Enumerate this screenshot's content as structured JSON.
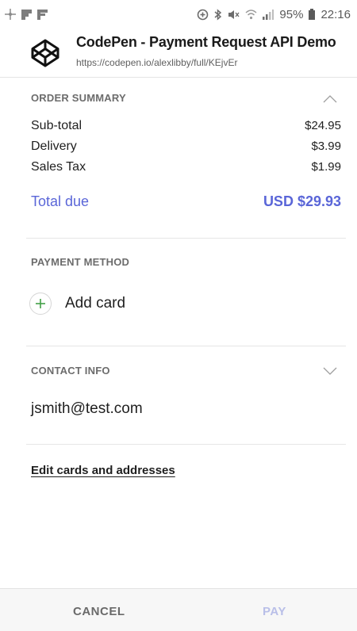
{
  "status_bar": {
    "left_icons": [
      "sync-icon",
      "flipboard-icon",
      "flipboard-alt-icon"
    ],
    "right_icons": [
      "data-saver-icon",
      "bluetooth-icon",
      "mute-icon",
      "wifi-icon",
      "signal-icon",
      "battery-icon"
    ],
    "battery": "95%",
    "time": "22:16"
  },
  "header": {
    "title": "CodePen - Payment Request API Demo",
    "url": "https://codepen.io/alexlibby/full/KEjvEr"
  },
  "order_summary": {
    "label": "ORDER SUMMARY",
    "items": [
      {
        "label": "Sub-total",
        "amount": "$24.95"
      },
      {
        "label": "Delivery",
        "amount": "$3.99"
      },
      {
        "label": "Sales Tax",
        "amount": "$1.99"
      }
    ],
    "total_label": "Total due",
    "total_amount": "USD $29.93"
  },
  "payment_method": {
    "label": "PAYMENT METHOD",
    "add_card_label": "Add card"
  },
  "contact_info": {
    "label": "CONTACT INFO",
    "email": "jsmith@test.com"
  },
  "edit_link": "Edit cards and addresses",
  "buttons": {
    "cancel": "CANCEL",
    "pay": "PAY"
  },
  "colors": {
    "accent": "#5a66d8",
    "pay_disabled": "#b9bfe8",
    "plus_green": "#43a047"
  }
}
